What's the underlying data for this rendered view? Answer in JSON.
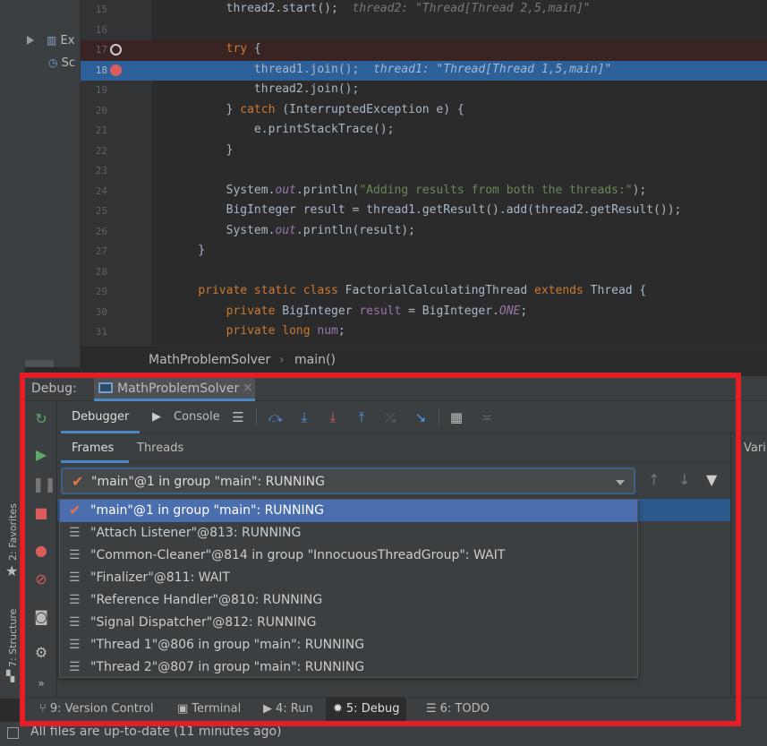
{
  "project_tree": {
    "items": [
      {
        "label": "Ex",
        "icon": "bar-chart-icon"
      },
      {
        "label": "Sc",
        "icon": "scratch-icon"
      }
    ]
  },
  "editor": {
    "lines": [
      {
        "num": "15",
        "code": "        thread2.start();  ",
        "hint": "thread2: \"Thread[Thread 2,5,main]\"",
        "state": ""
      },
      {
        "num": "16",
        "code": "",
        "state": ""
      },
      {
        "num": "17",
        "code": "        <kw>try</kw> {",
        "state": "bp"
      },
      {
        "num": "18",
        "code": "            thread1.join();  ",
        "hint": "thread1: \"Thread[Thread 1,5,main]\"",
        "state": "cur"
      },
      {
        "num": "19",
        "code": "            thread2.join();",
        "state": ""
      },
      {
        "num": "20",
        "code": "        } <kw>catch</kw> (InterruptedException e) {",
        "state": ""
      },
      {
        "num": "21",
        "code": "            e.printStackTrace();",
        "state": ""
      },
      {
        "num": "22",
        "code": "        }",
        "state": ""
      },
      {
        "num": "23",
        "code": "",
        "state": ""
      },
      {
        "num": "24",
        "code": "        System.<fld>out</fld>.println(<str>\"Adding results from both the threads:\"</str>);",
        "state": ""
      },
      {
        "num": "25",
        "code": "        BigInteger result = thread1.getResult().add(thread2.getResult());",
        "state": ""
      },
      {
        "num": "26",
        "code": "        System.<fld>out</fld>.println(result);",
        "state": ""
      },
      {
        "num": "27",
        "code": "    }",
        "state": ""
      },
      {
        "num": "28",
        "code": "",
        "state": ""
      },
      {
        "num": "29",
        "code": "    <kw>private static class</kw> FactorialCalculatingThread <kw>extends</kw> Thread {",
        "state": ""
      },
      {
        "num": "30",
        "code": "        <kw>private</kw> BigInteger <fld2>result</fld2> = BigInteger.<fld>ONE</fld>;",
        "state": ""
      },
      {
        "num": "31",
        "code": "        <kw>private long</kw> <fld2>num</fld2>;",
        "state": ""
      }
    ]
  },
  "breadcrumb": {
    "class_name": "MathProblemSolver",
    "method": "main()",
    "sep": "›"
  },
  "debug": {
    "label": "Debug:",
    "session_tab": "MathProblemSolver",
    "close": "×",
    "tabs": {
      "debugger": "Debugger",
      "console": "Console"
    },
    "subtabs": {
      "frames": "Frames",
      "threads": "Threads"
    },
    "right_pane_label": "Vari",
    "thread_selector": {
      "value": "\"main\"@1 in group \"main\": RUNNING"
    },
    "thread_options": [
      {
        "label": "\"main\"@1 in group \"main\": RUNNING",
        "selected": true
      },
      {
        "label": "\"Attach Listener\"@813: RUNNING",
        "selected": false
      },
      {
        "label": "\"Common-Cleaner\"@814 in group \"InnocuousThreadGroup\": WAIT",
        "selected": false
      },
      {
        "label": "\"Finalizer\"@811: WAIT",
        "selected": false
      },
      {
        "label": "\"Reference Handler\"@810: RUNNING",
        "selected": false
      },
      {
        "label": "\"Signal Dispatcher\"@812: RUNNING",
        "selected": false
      },
      {
        "label": "\"Thread 1\"@806 in group \"main\": RUNNING",
        "selected": false
      },
      {
        "label": "\"Thread 2\"@807 in group \"main\": RUNNING",
        "selected": false
      }
    ]
  },
  "left_strip": {
    "favorites": "2: Favorites",
    "structure": "7: Structure"
  },
  "bottom_bar": {
    "items": [
      {
        "label": "9: Version Control",
        "icon": "git-branch-icon"
      },
      {
        "label": "Terminal",
        "icon": "terminal-icon"
      },
      {
        "label": "4: Run",
        "icon": "run-icon"
      },
      {
        "label": "5: Debug",
        "icon": "bug-icon",
        "active": true
      },
      {
        "label": "6: TODO",
        "icon": "list-icon"
      }
    ]
  },
  "status": {
    "text": "All files are up-to-date (11 minutes ago)"
  },
  "colors": {
    "highlight_frame": "#e41e26",
    "selection": "#4b6eaf",
    "accent": "#4a88c7"
  }
}
